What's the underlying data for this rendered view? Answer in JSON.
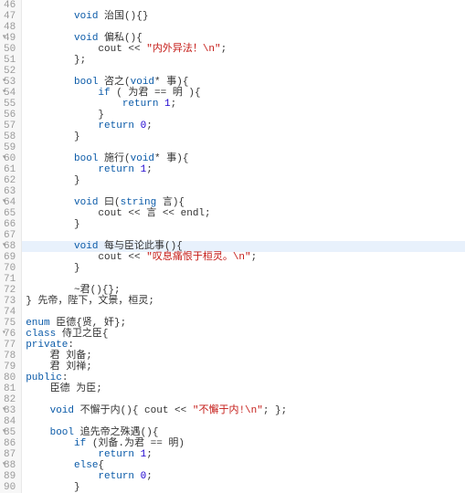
{
  "editor": {
    "first_line": 46,
    "highlight_line": 68,
    "fold_lines": [
      49,
      53,
      54,
      60,
      64,
      68,
      76,
      83,
      85,
      88
    ],
    "lines": [
      {
        "tokens": []
      },
      {
        "tokens": [
          {
            "t": "        ",
            "c": ""
          },
          {
            "t": "void",
            "c": "kw"
          },
          {
            "t": " 治国(){}",
            "c": ""
          }
        ]
      },
      {
        "tokens": []
      },
      {
        "tokens": [
          {
            "t": "        ",
            "c": ""
          },
          {
            "t": "void",
            "c": "kw"
          },
          {
            "t": " 偏私(){",
            "c": ""
          }
        ]
      },
      {
        "tokens": [
          {
            "t": "            cout << ",
            "c": ""
          },
          {
            "t": "\"内外异法！\\n\"",
            "c": "str"
          },
          {
            "t": ";",
            "c": ""
          }
        ]
      },
      {
        "tokens": [
          {
            "t": "        };",
            "c": ""
          }
        ]
      },
      {
        "tokens": []
      },
      {
        "tokens": [
          {
            "t": "        ",
            "c": ""
          },
          {
            "t": "bool",
            "c": "ty"
          },
          {
            "t": " 咨之(",
            "c": ""
          },
          {
            "t": "void",
            "c": "kw"
          },
          {
            "t": "* 事){",
            "c": ""
          }
        ]
      },
      {
        "tokens": [
          {
            "t": "            ",
            "c": ""
          },
          {
            "t": "if",
            "c": "kw"
          },
          {
            "t": " ( 为君 == 明 ){",
            "c": ""
          }
        ]
      },
      {
        "tokens": [
          {
            "t": "                ",
            "c": ""
          },
          {
            "t": "return",
            "c": "kw"
          },
          {
            "t": " ",
            "c": ""
          },
          {
            "t": "1",
            "c": "num"
          },
          {
            "t": ";",
            "c": ""
          }
        ]
      },
      {
        "tokens": [
          {
            "t": "            }",
            "c": ""
          }
        ]
      },
      {
        "tokens": [
          {
            "t": "            ",
            "c": ""
          },
          {
            "t": "return",
            "c": "kw"
          },
          {
            "t": " ",
            "c": ""
          },
          {
            "t": "0",
            "c": "num"
          },
          {
            "t": ";",
            "c": ""
          }
        ]
      },
      {
        "tokens": [
          {
            "t": "        }",
            "c": ""
          }
        ]
      },
      {
        "tokens": []
      },
      {
        "tokens": [
          {
            "t": "        ",
            "c": ""
          },
          {
            "t": "bool",
            "c": "ty"
          },
          {
            "t": " 施行(",
            "c": ""
          },
          {
            "t": "void",
            "c": "kw"
          },
          {
            "t": "* 事){",
            "c": ""
          }
        ]
      },
      {
        "tokens": [
          {
            "t": "            ",
            "c": ""
          },
          {
            "t": "return",
            "c": "kw"
          },
          {
            "t": " ",
            "c": ""
          },
          {
            "t": "1",
            "c": "num"
          },
          {
            "t": ";",
            "c": ""
          }
        ]
      },
      {
        "tokens": [
          {
            "t": "        }",
            "c": ""
          }
        ]
      },
      {
        "tokens": []
      },
      {
        "tokens": [
          {
            "t": "        ",
            "c": ""
          },
          {
            "t": "void",
            "c": "kw"
          },
          {
            "t": " 曰(",
            "c": ""
          },
          {
            "t": "string",
            "c": "ty"
          },
          {
            "t": " 言){",
            "c": ""
          }
        ]
      },
      {
        "tokens": [
          {
            "t": "            cout << 言 << endl;",
            "c": ""
          }
        ]
      },
      {
        "tokens": [
          {
            "t": "        }",
            "c": ""
          }
        ]
      },
      {
        "tokens": []
      },
      {
        "tokens": [
          {
            "t": "        ",
            "c": ""
          },
          {
            "t": "void",
            "c": "kw"
          },
          {
            "t": " 每与臣论此事(){",
            "c": ""
          }
        ]
      },
      {
        "tokens": [
          {
            "t": "            cout << ",
            "c": ""
          },
          {
            "t": "\"叹息痛恨于桓灵。\\n\"",
            "c": "str"
          },
          {
            "t": ";",
            "c": ""
          }
        ]
      },
      {
        "tokens": [
          {
            "t": "        }",
            "c": ""
          }
        ]
      },
      {
        "tokens": []
      },
      {
        "tokens": [
          {
            "t": "        ~君(){};",
            "c": ""
          }
        ]
      },
      {
        "tokens": [
          {
            "t": "} 先帝，陛下，文景，桓灵;",
            "c": ""
          }
        ]
      },
      {
        "tokens": []
      },
      {
        "tokens": [
          {
            "t": "enum",
            "c": "kw"
          },
          {
            "t": " 臣德{贤, 奸};",
            "c": ""
          }
        ]
      },
      {
        "tokens": [
          {
            "t": "class",
            "c": "kw"
          },
          {
            "t": " 侍卫之臣{",
            "c": ""
          }
        ]
      },
      {
        "tokens": [
          {
            "t": "private",
            "c": "kw"
          },
          {
            "t": ":",
            "c": ""
          }
        ]
      },
      {
        "tokens": [
          {
            "t": "    君 刘备;",
            "c": ""
          }
        ]
      },
      {
        "tokens": [
          {
            "t": "    君 刘禅;",
            "c": ""
          }
        ]
      },
      {
        "tokens": [
          {
            "t": "public",
            "c": "kw"
          },
          {
            "t": ":",
            "c": ""
          }
        ]
      },
      {
        "tokens": [
          {
            "t": "    臣德 为臣;",
            "c": ""
          }
        ]
      },
      {
        "tokens": []
      },
      {
        "tokens": [
          {
            "t": "    ",
            "c": ""
          },
          {
            "t": "void",
            "c": "kw"
          },
          {
            "t": " 不懈于内(){ cout << ",
            "c": ""
          },
          {
            "t": "\"不懈于内!\\n\"",
            "c": "str"
          },
          {
            "t": "; };",
            "c": ""
          }
        ]
      },
      {
        "tokens": []
      },
      {
        "tokens": [
          {
            "t": "    ",
            "c": ""
          },
          {
            "t": "bool",
            "c": "ty"
          },
          {
            "t": " 追先帝之殊遇(){",
            "c": ""
          }
        ]
      },
      {
        "tokens": [
          {
            "t": "        ",
            "c": ""
          },
          {
            "t": "if",
            "c": "kw"
          },
          {
            "t": " (刘备.为君 == 明)",
            "c": ""
          }
        ]
      },
      {
        "tokens": [
          {
            "t": "            ",
            "c": ""
          },
          {
            "t": "return",
            "c": "kw"
          },
          {
            "t": " ",
            "c": ""
          },
          {
            "t": "1",
            "c": "num"
          },
          {
            "t": ";",
            "c": ""
          }
        ]
      },
      {
        "tokens": [
          {
            "t": "        ",
            "c": ""
          },
          {
            "t": "else",
            "c": "kw"
          },
          {
            "t": "{",
            "c": ""
          }
        ]
      },
      {
        "tokens": [
          {
            "t": "            ",
            "c": ""
          },
          {
            "t": "return",
            "c": "kw"
          },
          {
            "t": " ",
            "c": ""
          },
          {
            "t": "0",
            "c": "num"
          },
          {
            "t": ";",
            "c": ""
          }
        ]
      },
      {
        "tokens": [
          {
            "t": "        }",
            "c": ""
          }
        ]
      }
    ]
  }
}
